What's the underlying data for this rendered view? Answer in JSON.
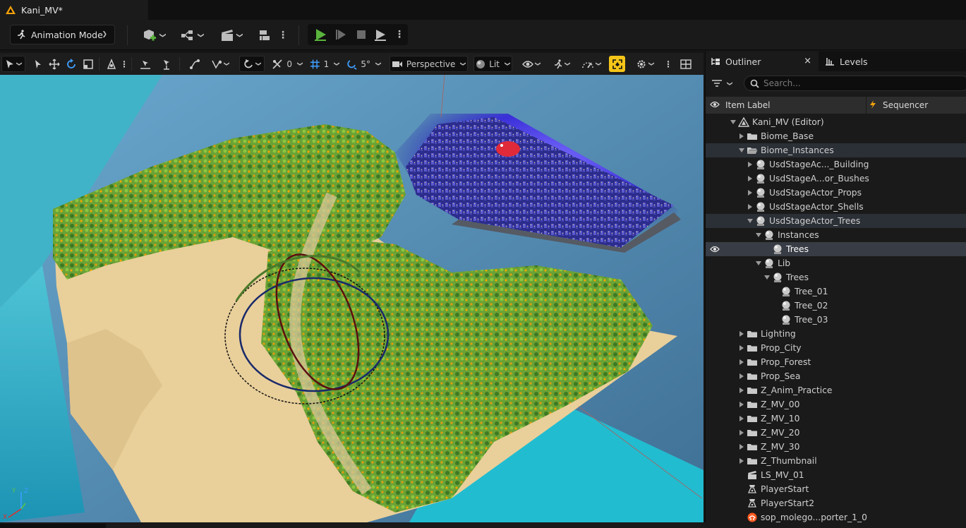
{
  "window": {
    "tab_title": "Kani_MV*"
  },
  "toolbar": {
    "mode_label": "Animation Mode",
    "icons": [
      "add-actor-icon",
      "blueprint-icon",
      "cinematics-icon",
      "build-icon",
      "play-icon",
      "advance-frame-icon",
      "stop-icon",
      "eject-icon"
    ]
  },
  "viewport_toolbar": {
    "grid_value": "0",
    "snap_value": "1",
    "rotation_snap_value": "5°",
    "view_mode": "Perspective",
    "lighting_mode": "Lit"
  },
  "axis_gizmo": {
    "x_label": "X",
    "y_label": "Y",
    "z_label": "Z"
  },
  "outliner": {
    "tab_title": "Outliner",
    "levels_tab": "Levels",
    "close_glyph": "×",
    "search_placeholder": "Search...",
    "columns": {
      "item_label": "Item Label",
      "sequencer": "Sequencer"
    },
    "rows": [
      {
        "label": "Kani_MV (Editor)",
        "depth": 0,
        "icon": "world-icon",
        "arrow": "open"
      },
      {
        "label": "Biome_Base",
        "depth": 1,
        "icon": "folder-icon",
        "arrow": "closed"
      },
      {
        "label": "Biome_Instances",
        "depth": 1,
        "icon": "folder-open-icon",
        "arrow": "open",
        "state": "sel"
      },
      {
        "label": "UsdStageAc..._Building",
        "depth": 2,
        "icon": "usd-actor-icon",
        "arrow": "closed"
      },
      {
        "label": "UsdStageA...or_Bushes",
        "depth": 2,
        "icon": "usd-actor-icon",
        "arrow": "closed"
      },
      {
        "label": "UsdStageActor_Props",
        "depth": 2,
        "icon": "usd-actor-icon",
        "arrow": "closed"
      },
      {
        "label": "UsdStageActor_Shells",
        "depth": 2,
        "icon": "usd-actor-icon",
        "arrow": "closed"
      },
      {
        "label": "UsdStageActor_Trees",
        "depth": 2,
        "icon": "usd-actor-icon",
        "arrow": "open",
        "state": "sel"
      },
      {
        "label": "Instances",
        "depth": 3,
        "icon": "usd-actor-icon",
        "arrow": "open"
      },
      {
        "label": "Trees",
        "depth": 4,
        "icon": "usd-actor-icon",
        "arrow": "none",
        "state": "hl",
        "eye": true
      },
      {
        "label": "Lib",
        "depth": 3,
        "icon": "usd-actor-icon",
        "arrow": "open"
      },
      {
        "label": "Trees",
        "depth": 4,
        "icon": "usd-actor-icon",
        "arrow": "open"
      },
      {
        "label": "Tree_01",
        "depth": 5,
        "icon": "usd-actor-icon",
        "arrow": "none"
      },
      {
        "label": "Tree_02",
        "depth": 5,
        "icon": "usd-actor-icon",
        "arrow": "none"
      },
      {
        "label": "Tree_03",
        "depth": 5,
        "icon": "usd-actor-icon",
        "arrow": "none"
      },
      {
        "label": "Lighting",
        "depth": 1,
        "icon": "folder-icon",
        "arrow": "closed"
      },
      {
        "label": "Prop_City",
        "depth": 1,
        "icon": "folder-icon",
        "arrow": "closed"
      },
      {
        "label": "Prop_Forest",
        "depth": 1,
        "icon": "folder-icon",
        "arrow": "closed"
      },
      {
        "label": "Prop_Sea",
        "depth": 1,
        "icon": "folder-icon",
        "arrow": "closed"
      },
      {
        "label": "Z_Anim_Practice",
        "depth": 1,
        "icon": "folder-icon",
        "arrow": "closed"
      },
      {
        "label": "Z_MV_00",
        "depth": 1,
        "icon": "folder-icon",
        "arrow": "closed"
      },
      {
        "label": "Z_MV_10",
        "depth": 1,
        "icon": "folder-icon",
        "arrow": "closed"
      },
      {
        "label": "Z_MV_20",
        "depth": 1,
        "icon": "folder-icon",
        "arrow": "closed"
      },
      {
        "label": "Z_MV_30",
        "depth": 1,
        "icon": "folder-icon",
        "arrow": "closed"
      },
      {
        "label": "Z_Thumbnail",
        "depth": 1,
        "icon": "folder-icon",
        "arrow": "closed"
      },
      {
        "label": "LS_MV_01",
        "depth": 1,
        "icon": "level-sequence-icon",
        "arrow": "none"
      },
      {
        "label": "PlayerStart",
        "depth": 1,
        "icon": "player-start-icon",
        "arrow": "none"
      },
      {
        "label": "PlayerStart2",
        "depth": 1,
        "icon": "player-start-icon",
        "arrow": "none"
      },
      {
        "label": "sop_molego...porter_1_0",
        "depth": 1,
        "icon": "houdini-icon",
        "arrow": "none"
      }
    ]
  },
  "colors": {
    "accent_blue": "#3f9fff",
    "play_green": "#5ab43c",
    "snap_highlight": "#f5c518",
    "folder": "#c9c9c9",
    "selected_row": "#383c44"
  }
}
